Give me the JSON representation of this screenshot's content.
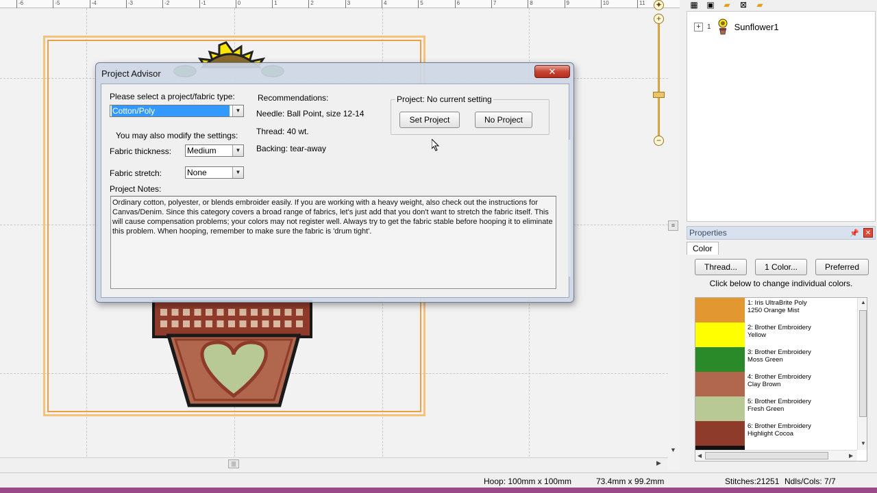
{
  "ruler": {
    "labels": [
      "-6",
      "-5",
      "-4",
      "-3",
      "-2",
      "-1",
      "0",
      "1",
      "2",
      "3",
      "4",
      "5",
      "6",
      "7",
      "8",
      "9",
      "10",
      "11"
    ]
  },
  "tree": {
    "expander": "+",
    "number": "1",
    "label": "Sunflower1"
  },
  "properties": {
    "title": "Properties",
    "tab": "Color",
    "buttons": [
      "Thread...",
      "1 Color...",
      "Preferred"
    ],
    "hint": "Click below to change individual colors.",
    "colors": [
      {
        "line1": "1: Iris UltraBrite Poly",
        "line2": "1250 Orange Mist",
        "hex": "#e39730"
      },
      {
        "line1": "2: Brother Embroidery",
        "line2": "Yellow",
        "hex": "#ffff00"
      },
      {
        "line1": "3: Brother Embroidery",
        "line2": "Moss Green",
        "hex": "#2a8a2a"
      },
      {
        "line1": "4: Brother Embroidery",
        "line2": "Clay Brown",
        "hex": "#b0674d"
      },
      {
        "line1": "5: Brother Embroidery",
        "line2": "Fresh Green",
        "hex": "#b8c996"
      },
      {
        "line1": "6: Brother Embroidery",
        "line2": "Highlight Cocoa",
        "hex": "#8e3b2b"
      }
    ]
  },
  "status": {
    "hoop": "Hoop: 100mm x 100mm",
    "size": "73.4mm x 99.2mm",
    "stitches": "Stitches:21251",
    "ndls": "Ndls/Cols: 7/7"
  },
  "dialog": {
    "title": "Project Advisor",
    "close_label": "✕",
    "select_label": "Please select a project/fabric type:",
    "fabric_type": "Cotton/Poly",
    "modify_label": "You may also modify the settings:",
    "thickness_label": "Fabric thickness:",
    "thickness_value": "Medium",
    "stretch_label": "Fabric stretch:",
    "stretch_value": "None",
    "recommendations_label": "Recommendations:",
    "needle": "Needle: Ball Point, size 12-14",
    "thread": "Thread: 40 wt.",
    "backing": "Backing: tear-away",
    "project_group_label": "Project: No current setting",
    "set_project": "Set Project",
    "no_project": "No Project",
    "notes_label": "Project Notes:",
    "notes": "Ordinary cotton, polyester, or blends embroider easily. If you are working with a heavy weight, also check out the instructions for Canvas/Denim. Since this category covers a broad range of fabrics, let's just add that you don't want to stretch the fabric itself. This will cause compensation problems; your colors may not register well. Always try to get the fabric stable before hooping it to eliminate this problem. When hooping, remember to make sure the fabric is 'drum tight'."
  },
  "colors": {
    "hoop_outer": "#f6c27a",
    "hoop_inner": "#e9a046",
    "selection": "#3399ff",
    "close_red": "#c74434",
    "status_strip": "#9b4a88"
  }
}
